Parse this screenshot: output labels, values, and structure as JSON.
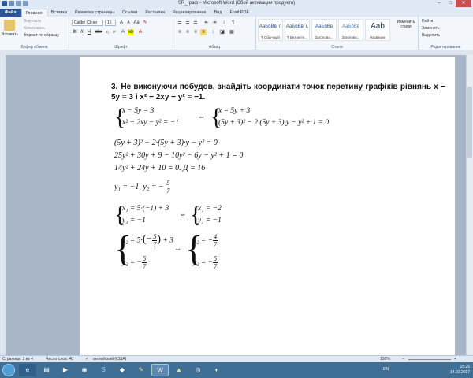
{
  "window": {
    "title": "SR_граф - Microsoft Word (Сбой активации продукта)",
    "minimize": "–",
    "maximize": "□",
    "close": "✕"
  },
  "tabs": [
    "Файл",
    "Главная",
    "Вставка",
    "Разметка страницы",
    "Ссылки",
    "Рассылки",
    "Рецензирование",
    "Вид",
    "Foxit PDF"
  ],
  "ribbon": {
    "clipboard": {
      "paste": "Вставить",
      "cut": "Вырезать",
      "copy": "Копировать",
      "format_painter": "Формат по образцу",
      "label": "Буфер обмена"
    },
    "font": {
      "name": "Calibri (Осно",
      "size": "16",
      "label": "Шрифт"
    },
    "paragraph": {
      "label": "Абзац"
    },
    "styles": {
      "items": [
        {
          "preview": "АаБбВвГг,",
          "name": "¶ Обычный"
        },
        {
          "preview": "АаБбВвГг,",
          "name": "¶ Без инте..."
        },
        {
          "preview": "АаБбВв",
          "name": "Заголово..."
        },
        {
          "preview": "АаБбВв",
          "name": "Заголово..."
        },
        {
          "preview": "Aab",
          "name": "Название"
        }
      ],
      "change": "Изменить стили",
      "label": "Стили"
    },
    "editing": {
      "find": "Найти",
      "replace": "Заменить",
      "select": "Выделить",
      "label": "Редактирование"
    }
  },
  "document": {
    "heading_number": "3.",
    "heading_text": "Не виконуючи побудов, знайдіть координати точок перетину графіків рівнянь x − 5y = 3 і x² − 2xy − y² = −1.",
    "lines": {
      "sys1a": "x − 5y = 3",
      "sys1b": "x² − 2xy − y² = −1",
      "arrow": "⇔",
      "sys2a": "x = 5y + 3",
      "sys2b": "(5y + 3)² − 2·(5y + 3)·y − y² + 1 = 0",
      "l1": "(5y + 3)² − 2·(5y + 3)·y − y² = 0",
      "l2": "25y² + 30y + 9 − 10y² − 6y − y² + 1 = 0",
      "l3": "14y² + 24y + 10 = 0.   Д = 16",
      "l4a": "y₁ = −1, y₂ = −",
      "l4n": "5",
      "l4d": "7",
      "s3a": "x₁ = 5·(−1) + 3",
      "s3b": "y₁ = −1",
      "s4a": "x₁ = −2",
      "s4b": "y₁ = −1",
      "s5a_pre": "x₂ = 5·",
      "s5a_paren_open": "(−",
      "s5a_n": "5",
      "s5a_d": "7",
      "s5a_paren_close": ")",
      "s5a_post": "+ 3",
      "s5b_pre": "y₂ = −",
      "s5b_n": "5",
      "s5b_d": "7",
      "s6a_pre": "x₂ = −",
      "s6a_n": "4",
      "s6a_d": "7",
      "s6b_pre": "y₂ = −",
      "s6b_n": "5",
      "s6b_d": "7"
    }
  },
  "status": {
    "page": "Страница: 3 из 4",
    "words": "Число слов: 40",
    "language": "английский (США)",
    "zoom": "138%"
  },
  "taskbar": {
    "lang": "EN",
    "time": "15:26",
    "date": "14.02.2017"
  },
  "colors": {
    "file_tab": "#2a5699",
    "taskbar": "#3f6f95",
    "close_button": "#c75050"
  }
}
